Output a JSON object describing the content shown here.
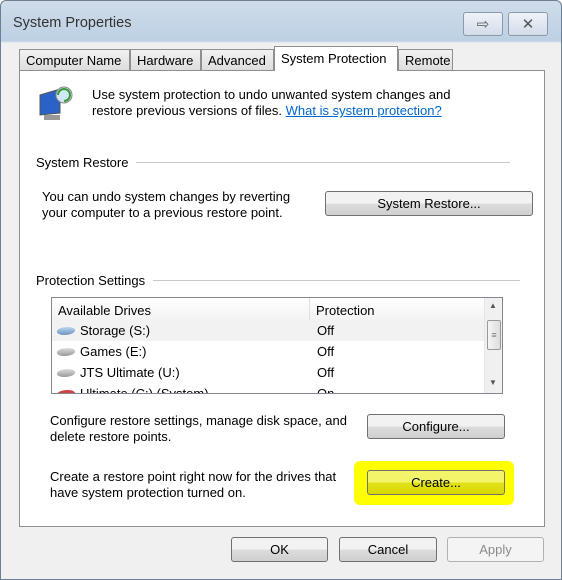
{
  "window": {
    "title": "System Properties",
    "help_icon": "help-icon",
    "close_icon": "close-icon"
  },
  "tabs": [
    {
      "label": "Computer Name"
    },
    {
      "label": "Hardware"
    },
    {
      "label": "Advanced"
    },
    {
      "label": "System Protection",
      "active": true
    },
    {
      "label": "Remote"
    }
  ],
  "intro": {
    "text": "Use system protection to undo unwanted system changes and restore previous versions of files.",
    "link": "What is system protection?"
  },
  "system_restore": {
    "heading": "System Restore",
    "text": "You can undo system changes by reverting your computer to a previous restore point.",
    "button": "System Restore..."
  },
  "protection": {
    "heading": "Protection Settings",
    "columns": [
      "Available Drives",
      "Protection"
    ],
    "drives": [
      {
        "name": "Storage (S:)",
        "protection": "Off",
        "selected": true
      },
      {
        "name": "Games (E:)",
        "protection": "Off"
      },
      {
        "name": "JTS Ultimate (U:)",
        "protection": "Off"
      },
      {
        "name": "Ultimate (C:) (System)",
        "protection": "On"
      }
    ],
    "configure_text": "Configure restore settings, manage disk space, and delete restore points.",
    "configure_button": "Configure...",
    "create_text": "Create a restore point right now for the drives that have system protection turned on.",
    "create_button": "Create...",
    "highlight_color": "#ffff00"
  },
  "footer": {
    "ok": "OK",
    "cancel": "Cancel",
    "apply": "Apply"
  }
}
